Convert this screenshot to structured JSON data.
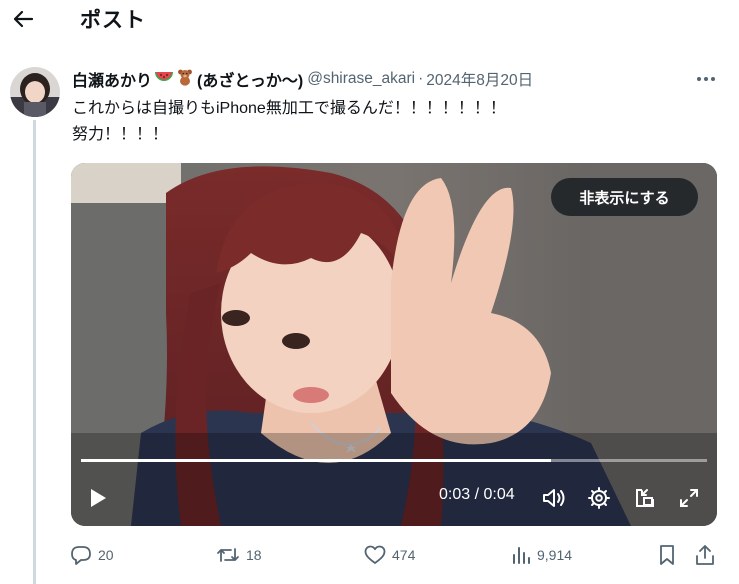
{
  "header": {
    "title": "ポスト"
  },
  "post": {
    "display_name": "白瀬あかり",
    "name_suffix": "(あざとっか〜)",
    "handle": "@shirase_akari",
    "separator": "·",
    "date": "2024年8月20日",
    "text": "これからは自撮りもiPhone無加工で撮るんだ！！！！！！！\n努力！！！！"
  },
  "media": {
    "hide_label": "非表示にする",
    "time_display": "0:03 / 0:04",
    "progress": 0.75
  },
  "actions": {
    "replies": "20",
    "reposts": "18",
    "likes": "474",
    "views": "9,914"
  },
  "icons": {
    "back": "back-arrow-icon",
    "more": "more-icon",
    "emoji_1": "watermelon-icon",
    "emoji_2": "teddy-bear-icon",
    "play": "play-icon",
    "volume": "volume-icon",
    "settings": "settings-icon",
    "pip": "picture-in-picture-icon",
    "fullscreen": "fullscreen-icon",
    "reply": "reply-icon",
    "repost": "repost-icon",
    "like": "heart-icon",
    "views": "views-icon",
    "bookmark": "bookmark-icon",
    "share": "share-icon"
  },
  "colors": {
    "text_primary": "#0f1419",
    "text_secondary": "#536471",
    "thread_line": "#cfd9de"
  }
}
